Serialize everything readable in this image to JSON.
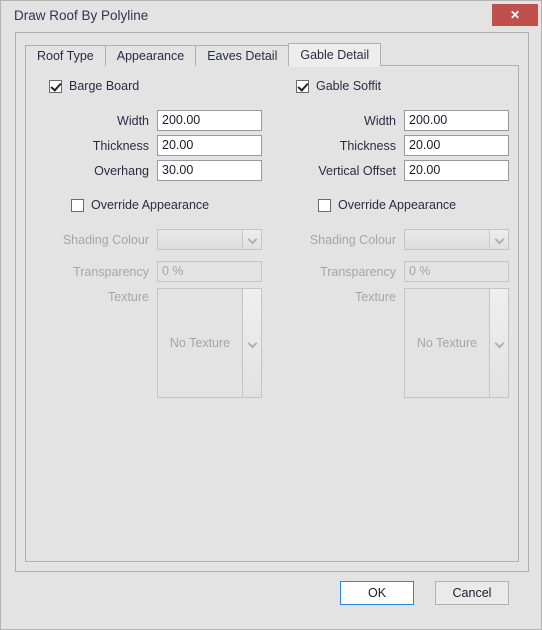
{
  "window": {
    "title": "Draw Roof By Polyline",
    "close_label": "✕",
    "accent_close": "#c0504d",
    "accent_focus": "#2a8ade"
  },
  "tabs": [
    {
      "label": "Roof Type",
      "active": false
    },
    {
      "label": "Appearance",
      "active": false
    },
    {
      "label": "Eaves Detail",
      "active": false
    },
    {
      "label": "Gable Detail",
      "active": true
    }
  ],
  "left_panel": {
    "group_checkbox": {
      "label": "Barge Board",
      "checked": true
    },
    "fields": [
      {
        "label": "Width",
        "value": "200.00"
      },
      {
        "label": "Thickness",
        "value": "20.00"
      },
      {
        "label": "Overhang",
        "value": "30.00"
      }
    ],
    "override": {
      "label": "Override Appearance",
      "checked": false
    },
    "shading_colour": {
      "label": "Shading Colour",
      "value": ""
    },
    "transparency": {
      "label": "Transparency",
      "value": "0 %"
    },
    "texture": {
      "label": "Texture",
      "value": "No Texture"
    }
  },
  "right_panel": {
    "group_checkbox": {
      "label": "Gable Soffit",
      "checked": true
    },
    "fields": [
      {
        "label": "Width",
        "value": "200.00"
      },
      {
        "label": "Thickness",
        "value": "20.00"
      },
      {
        "label": "Vertical Offset",
        "value": "20.00"
      }
    ],
    "override": {
      "label": "Override Appearance",
      "checked": false
    },
    "shading_colour": {
      "label": "Shading Colour",
      "value": ""
    },
    "transparency": {
      "label": "Transparency",
      "value": "0 %"
    },
    "texture": {
      "label": "Texture",
      "value": "No Texture"
    }
  },
  "footer": {
    "ok_label": "OK",
    "cancel_label": "Cancel"
  }
}
